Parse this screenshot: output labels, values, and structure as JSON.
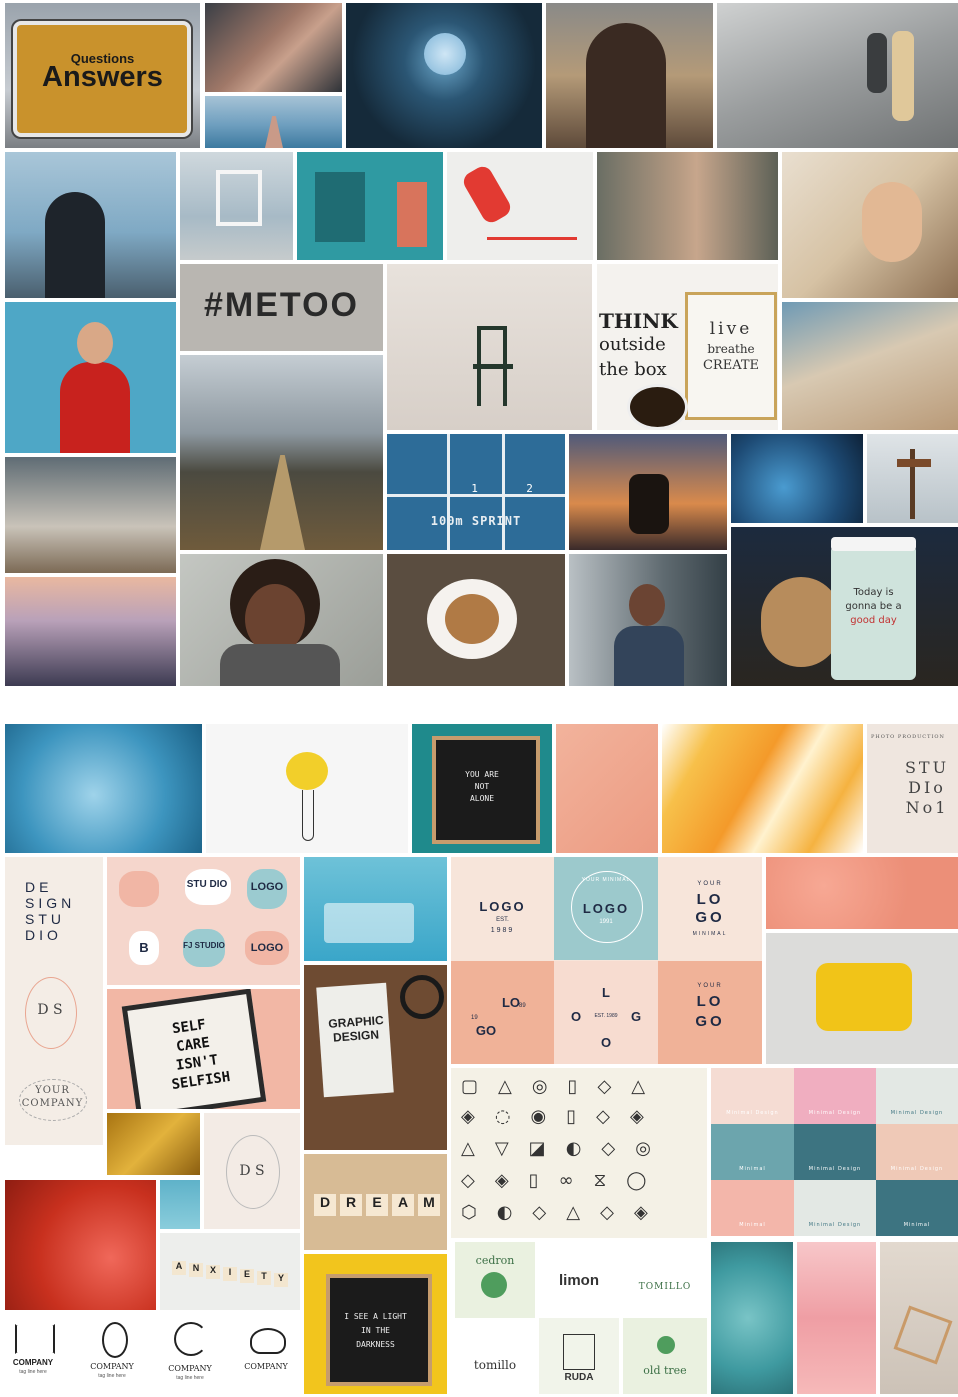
{
  "top": {
    "sign": {
      "line1": "Questions",
      "line2": "Answers"
    },
    "metoo": "#METOO",
    "think_outside": [
      "THINK",
      "outside",
      "the box"
    ],
    "frame_text": [
      "live",
      "breathe",
      "CREATE"
    ],
    "sprint": "100m SPRINT",
    "lanes": [
      "1",
      "2"
    ],
    "cup_text": [
      "Today is",
      "gonna be a",
      "good day"
    ]
  },
  "bottom": {
    "letterboard1": [
      "YOU ARE",
      "NOT",
      "ALONE"
    ],
    "studio_no1": {
      "ring": "PHOTO PRODUCTION",
      "lines": [
        "STU",
        "DIo",
        "No1"
      ]
    },
    "design_studio": [
      "DE",
      "SIGN",
      "STU",
      "DIO"
    ],
    "ds_mark": "D S",
    "your_company": [
      "YOUR",
      "COMPANY"
    ],
    "stamp_labels": [
      "STU DIO",
      "LOGO",
      "B",
      "FJ STUDIO",
      "LOGO"
    ],
    "self_care": [
      "SELF",
      "CARE",
      "ISN'T",
      "SELFISH"
    ],
    "book": [
      "GRAPHIC",
      "DESIGN"
    ],
    "dream": [
      "D",
      "R",
      "E",
      "A",
      "M"
    ],
    "anxiety": [
      "A",
      "N",
      "X",
      "I",
      "E",
      "T",
      "Y"
    ],
    "letterboard2": [
      "I SEE A LIGHT",
      "IN THE",
      "DARKNESS"
    ],
    "logos": [
      {
        "top": "LOGO",
        "sub": "EST.",
        "year": "1989"
      },
      {
        "top": "LOGO",
        "ring": "YOUR MINIMAL",
        "year": "1991"
      },
      {
        "top": "YOUR",
        "main": [
          "LO",
          "GO"
        ],
        "sub": "MINIMAL"
      },
      {
        "main": [
          "LO",
          "GO"
        ],
        "left": "19",
        "right": "89"
      },
      {
        "letters": [
          "L",
          "O",
          "G",
          "O"
        ],
        "mid": "EST. 1989"
      },
      {
        "top": "YOUR",
        "main": [
          "LO",
          "GO"
        ]
      }
    ],
    "minimal_labels": [
      "Minimal Design",
      "Minimal Design",
      "Minimal Design",
      "Minimal",
      "Minimal Design",
      "Minimal Design",
      "Minimal",
      "Minimal Design",
      "Minimal"
    ],
    "brands": [
      "cedron",
      "limon",
      "TOMILLO",
      "tomillo",
      "RUDA",
      "old tree"
    ],
    "companies": [
      "COMPANY",
      "COMPANY",
      "COMPANY",
      "COMPANY"
    ],
    "tagline": "tag line here"
  },
  "colors": {
    "peach": "#f4c2a8",
    "coral": "#ee9e86",
    "teal": "#3f6f7b",
    "cream": "#f3ece4",
    "mustard": "#e0b33a"
  }
}
